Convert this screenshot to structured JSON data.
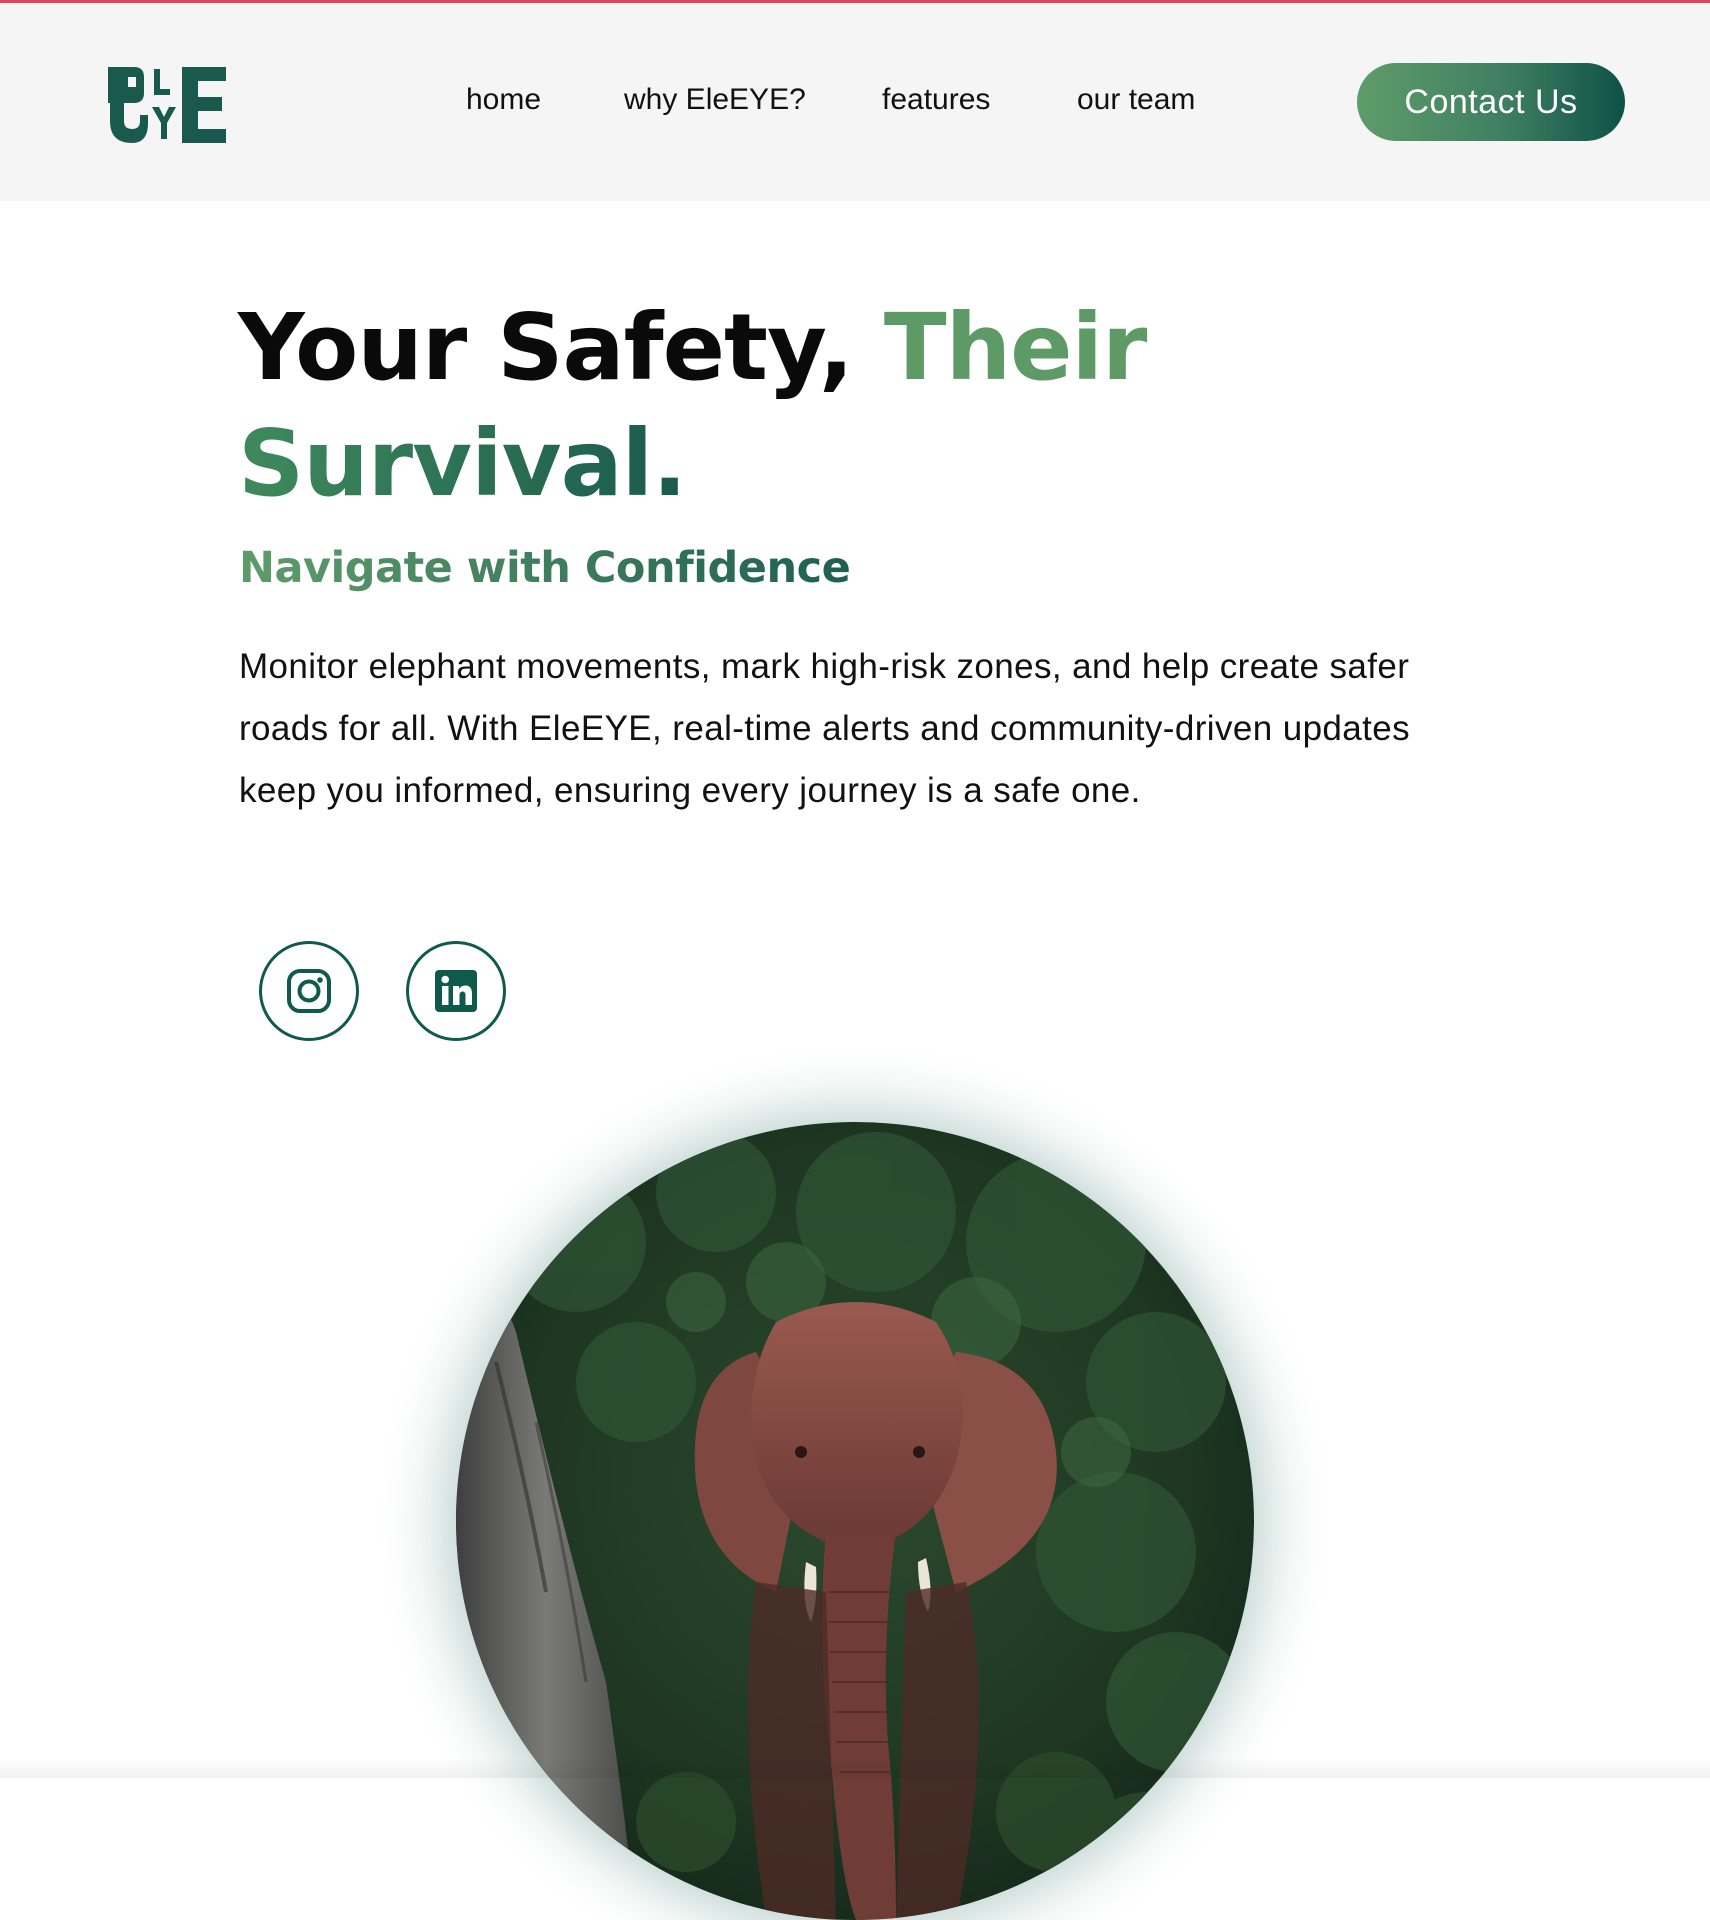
{
  "brand": {
    "logo_text": "ELEYE",
    "logo_color": "#1a5a4e"
  },
  "nav": {
    "links": [
      {
        "label": "home"
      },
      {
        "label": "why EleEYE?"
      },
      {
        "label": "features"
      },
      {
        "label": "our team"
      }
    ],
    "cta_label": "Contact Us"
  },
  "hero": {
    "title_part1": "Your Safety, ",
    "title_part2": "Their",
    "title_part3": "Survival.",
    "subtitle": "Navigate with Confidence",
    "description": "Monitor elephant movements, mark high-risk zones, and help create safer roads for all. With EleEYE, real-time alerts and community-driven updates keep you informed, ensuring every journey is a safe one.",
    "social": [
      {
        "icon": "instagram-icon"
      },
      {
        "icon": "linkedin-icon"
      }
    ],
    "image_subject": "elephant in forest"
  },
  "colors": {
    "accent_green": "#5d9a66",
    "dark_teal": "#0f5a4c",
    "top_bar": "#e0455c",
    "header_bg": "#f5f5f5"
  }
}
